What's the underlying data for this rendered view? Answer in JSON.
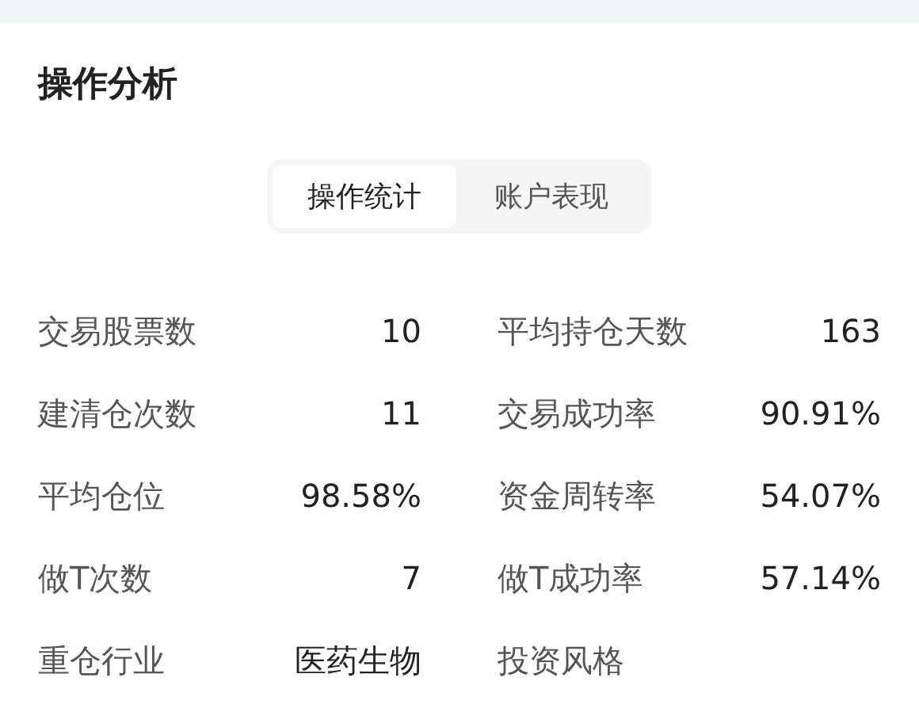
{
  "title": "操作分析",
  "tabs": [
    {
      "label": "操作统计",
      "selected": true
    },
    {
      "label": "账户表现",
      "selected": false
    }
  ],
  "stats": [
    {
      "label": "交易股票数",
      "value": "10"
    },
    {
      "label": "平均持仓天数",
      "value": "163"
    },
    {
      "label": "建清仓次数",
      "value": "11"
    },
    {
      "label": "交易成功率",
      "value": "90.91%"
    },
    {
      "label": "平均仓位",
      "value": "98.58%"
    },
    {
      "label": "资金周转率",
      "value": "54.07%"
    },
    {
      "label": "做T次数",
      "value": "7"
    },
    {
      "label": "做T成功率",
      "value": "57.14%"
    },
    {
      "label": "重仓行业",
      "value": "医药生物"
    },
    {
      "label": "投资风格"
    }
  ]
}
